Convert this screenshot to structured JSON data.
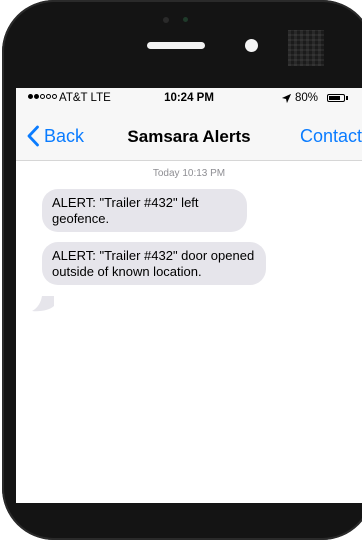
{
  "status_bar": {
    "carrier": "AT&T LTE",
    "time": "10:24 PM",
    "battery": "80%",
    "battery_level": 0.8,
    "signal_bars_filled": 2,
    "signal_bars_total": 5
  },
  "nav": {
    "back_label": "Back",
    "title": "Samsara Alerts",
    "contact_label": "Contact"
  },
  "conversation": {
    "timestamp": "Today 10:13 PM",
    "messages": [
      {
        "text": "ALERT: \"Trailer #432\" left geofence."
      },
      {
        "text": "ALERT: \"Trailer #432\" door opened outside of known location."
      }
    ]
  },
  "colors": {
    "accent": "#0a7cff",
    "bubble": "#e6e5eb",
    "phone_body": "#141414"
  },
  "icons": [
    "chevron-left-icon",
    "location-arrow-icon",
    "battery-icon",
    "signal-dots-icon"
  ]
}
